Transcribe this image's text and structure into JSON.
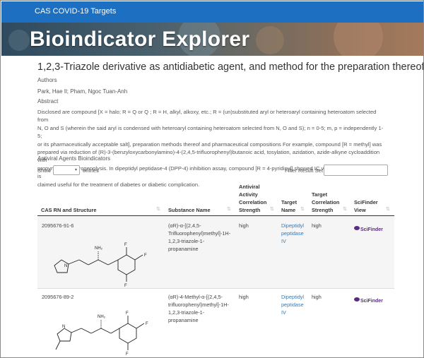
{
  "topbar": {
    "title": "CAS COVID-19 Targets"
  },
  "banner": {
    "title": "Bioindicator Explorer"
  },
  "document": {
    "title": "1,2,3-Triazole derivative as antidiabetic agent, and method for the preparation thereof",
    "authors_label": "Authors",
    "authors": "Park, Hae Il; Pham, Ngoc Tuan-Anh",
    "abstract_label": "Abstract",
    "abstract_lines": [
      "Disclosed are compound [X = halo; R = Q or Q ; R = H, alkyl, alkoxy, etc.; R = (un)substituted aryl or heteroaryl containing heteroatom selected from",
      "N, O and S (wherein the said aryl is condensed with heteroaryl containing heteroatom selected from N, O and S); n = 0-5; m, p = independently 1-5;",
      "or its pharmaceutically acceptable salt], preparation methods thereof and pharmaceutical compositions For example, compound [R = methyl] was",
      "prepared via reduction of (R)-3-(benzyloxycarbonylamino)-4-(2,4,5-trifluorophenyl)butanoic acid, tosylation, azidation, azide-alkyne cycloaddition with",
      "propyne, and hydrogenolysis. In dipeptidyl peptidase-4 (DPP-4) inhibition assay, compound [R = 4-pyridinyl] showed IC value of 14 nM. Compound is",
      "claimed useful for the treatment of diabetes or diabetic complication."
    ]
  },
  "table_section": {
    "title": "Antiviral Agents Bioindicators",
    "show_label": "Show",
    "entries_label": "entries",
    "filter_label": "Filter Result Set",
    "columns": [
      {
        "lines": [
          "CAS RN and Structure"
        ]
      },
      {
        "lines": [
          "Substance Name"
        ]
      },
      {
        "lines": [
          "Antiviral",
          "Activity",
          "Correlation",
          "Strength"
        ]
      },
      {
        "lines": [
          "Target",
          "Name"
        ]
      },
      {
        "lines": [
          "Target",
          "Correlation",
          "Strength"
        ]
      },
      {
        "lines": [
          "SciFinder",
          "View"
        ]
      }
    ],
    "rows": [
      {
        "cas_rn": "2095676-91-6",
        "substance_lines": [
          "(αR)-α-[(2,4,5-",
          "Trifluorophenyl)methyl]-1H-",
          "1,2,3-triazole-1-",
          "propanamine"
        ],
        "activity": "high",
        "target_lines": [
          "Dipeptidyl",
          "peptidase",
          "IV"
        ],
        "target_strength": "high",
        "scifinder": "SciFinder"
      },
      {
        "cas_rn": "2095676-89-2",
        "substance_lines": [
          "(αR)-4-Methyl-α-[(2,4,5-",
          "trifluorophenyl)methyl]-1H-",
          "1,2,3-triazole-1-",
          "propanamine"
        ],
        "activity": "high",
        "target_lines": [
          "Dipeptidyl",
          "peptidase",
          "IV"
        ],
        "target_strength": "high",
        "scifinder": "SciFinder"
      }
    ],
    "structure_atoms": {
      "nh2": "NH₂",
      "n": "N",
      "f": "F"
    }
  },
  "colors": {
    "topbar": "#1d6fc2",
    "link": "#337ab7",
    "scifinder": "#5a2d82"
  }
}
